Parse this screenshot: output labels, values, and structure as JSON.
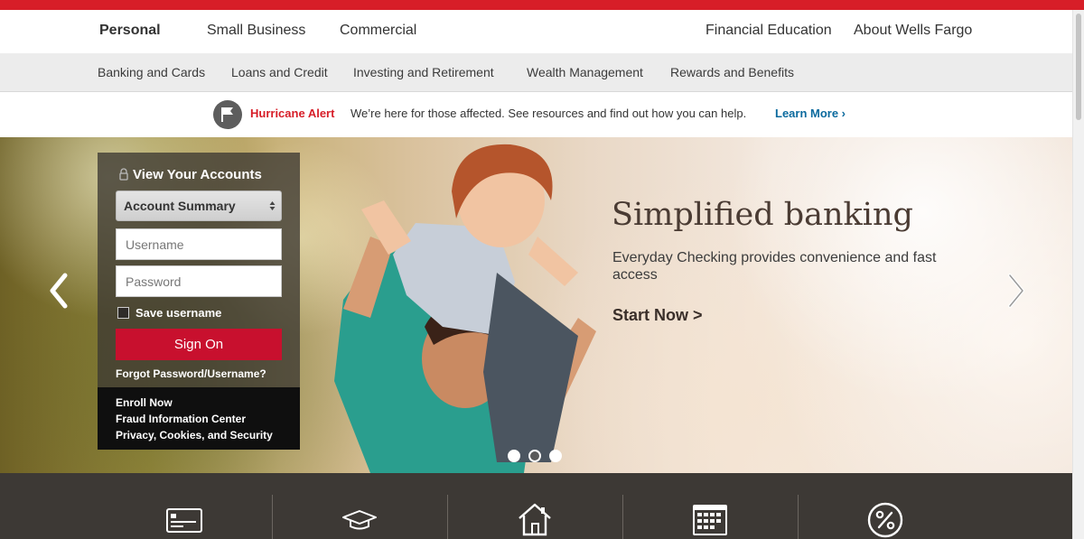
{
  "nav_primary": {
    "left": [
      "Personal",
      "Small Business",
      "Commercial"
    ],
    "right": [
      "Financial Education",
      "About Wells Fargo"
    ]
  },
  "nav_secondary": [
    "Banking and Cards",
    "Loans and Credit",
    "Investing and Retirement",
    "Wealth Management",
    "Rewards and Benefits"
  ],
  "alert": {
    "label": "Hurricane Alert",
    "message": "We’re here for those affected. See resources and find out how you can help.",
    "link": "Learn More ›",
    "icon": "flag-icon"
  },
  "login": {
    "title": "View Your Accounts",
    "destination": "Account Summary",
    "username_placeholder": "Username",
    "password_placeholder": "Password",
    "save_username": "Save username",
    "sign_on": "Sign On",
    "forgot": "Forgot Password/Username?",
    "links": [
      "Enroll Now",
      "Fraud Information Center",
      "Privacy, Cookies, and Security"
    ]
  },
  "hero": {
    "title": "Simplified banking",
    "subtitle": "Everyday Checking provides convenience and fast access",
    "cta": "Start Now >",
    "slides_total": 3,
    "active_slide": 2
  },
  "feature_icons": [
    "credit-card-icon",
    "graduation-cap-icon",
    "house-icon",
    "calendar-icon",
    "percent-icon"
  ],
  "colors": {
    "brand_red": "#d71e28",
    "signon_red": "#c8102e",
    "link_blue": "#0b6a9e"
  }
}
